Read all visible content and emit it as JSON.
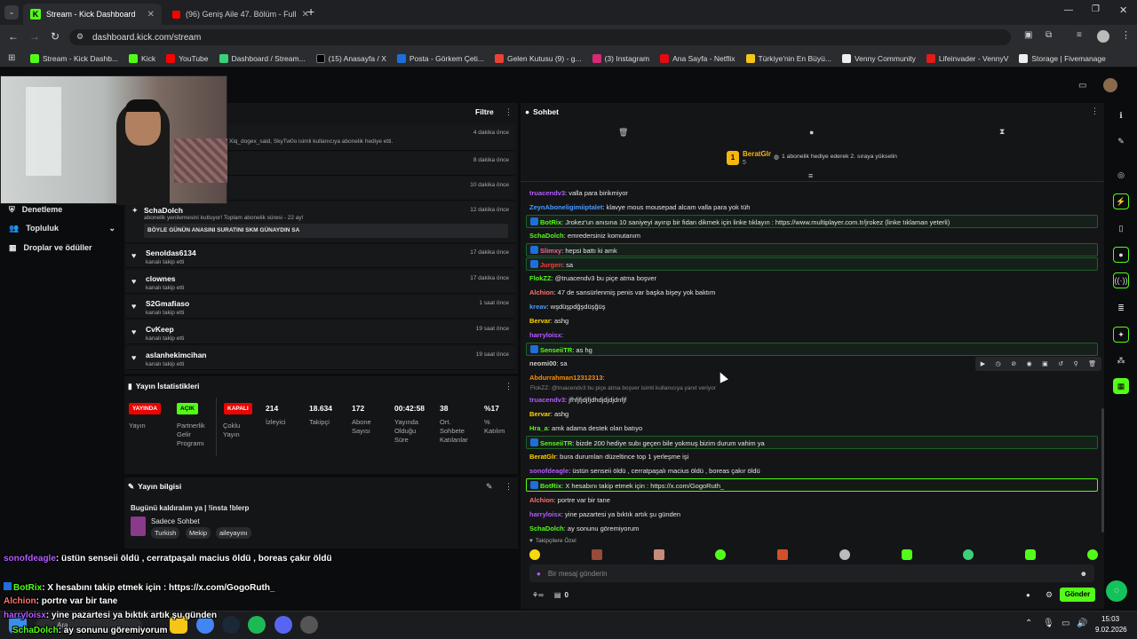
{
  "browser": {
    "tabs": [
      {
        "title": "Stream - Kick Dashboard",
        "active": true
      },
      {
        "title": "(96) Geniş Aile 47. Bölüm - Full",
        "active": false
      }
    ],
    "url": "dashboard.kick.com/stream",
    "bookmarks": [
      "Stream - Kick Dashb...",
      "Kick",
      "YouTube",
      "Dashboard / Stream...",
      "(15) Anasayfa / X",
      "Posta - Görkem Çeti...",
      "Gelen Kutusu (9) - g...",
      "(3) Instagram",
      "Ana Sayfa - Netflix",
      "Türkiye'nin En Büyü...",
      "Venny Community",
      "Lifeinvader - VennyV",
      "Storage | Fivemanage"
    ]
  },
  "sidebar": {
    "items": [
      {
        "label": "Denetleme"
      },
      {
        "label": "Topluluk"
      },
      {
        "label": "Droplar ve ödüller"
      }
    ]
  },
  "activity": {
    "filter_label": "Filtre",
    "rows": [
      {
        "name": "",
        "text": "Xiq_dogex_said, SkyTw0o isimli kullanıcıya abonelik hediye etti.",
        "time": "4 dakika önce"
      },
      {
        "name": "",
        "text": "",
        "time": "8 dakika önce"
      },
      {
        "name": "",
        "text": "",
        "time": "10 dakika önce"
      },
      {
        "name": "SchaDolch",
        "text": "abonelik yenilemesini kutluyor! Toplam abonelik süresi - 22 ay!",
        "time": "12 dakika önce",
        "message": "BÖYLE GÜNÜN ANASINI SURATINI SKM GÜNAYDIN SA"
      },
      {
        "name": "Senoldas6134",
        "text": "kanalı takip etti",
        "time": "17 dakika önce"
      },
      {
        "name": "clownes",
        "text": "kanalı takip etti",
        "time": "17 dakika önce"
      },
      {
        "name": "S2Gmafiaso",
        "text": "kanalı takip etti",
        "time": "1 saat önce"
      },
      {
        "name": "CvKeep",
        "text": "kanalı takip etti",
        "time": "19 saat önce"
      },
      {
        "name": "aslanhekimcihan",
        "text": "kanalı takip etti",
        "time": "19 saat önce"
      }
    ]
  },
  "stats": {
    "title": "Yayın İstatistikleri",
    "badges": [
      {
        "value": "YAYINDA",
        "label": "Yayın",
        "color": "#eb0400"
      },
      {
        "value": "AÇIK",
        "label": "Partnerlik Gelir Programı",
        "color": "#53fc18"
      },
      {
        "value": "KAPALI",
        "label": "Çoklu Yayın",
        "color": "#eb0400"
      }
    ],
    "numbers": [
      {
        "value": "214",
        "label": "İzleyici"
      },
      {
        "value": "18.634",
        "label": "Takipçi"
      },
      {
        "value": "172",
        "label": "Abone Sayısı"
      },
      {
        "value": "00:42:58",
        "label": "Yayında Olduğu Süre"
      },
      {
        "value": "38",
        "label": "Ort. Sohbete Katılanlar"
      },
      {
        "value": "%17",
        "label": "% Katılım"
      }
    ]
  },
  "stream_info": {
    "title": "Yayın bilgisi",
    "stream_title": "Bugünü kaldıralım ya | !insta !blerp",
    "category": "Sadece Sohbet",
    "tags": [
      "Turkish",
      "Mekip",
      "aileyayını"
    ]
  },
  "overlay_chat": [
    {
      "user": "sonofdeagle",
      "text": ": üstün senseii öldü , cerratpaşalı macius öldü , boreas çakır öldü",
      "color": "#b35cff"
    },
    {
      "user": "BotRix",
      "text": ": X hesabını takip etmek için : https://x.com/GogoRuth_",
      "color": "#53fc18"
    },
    {
      "user": "Alchion",
      "text": ": portre var bir tane",
      "color": "#ff7070"
    },
    {
      "user": "harryloisx",
      "text": ": yine pazartesi ya bıktık artık şu günden",
      "color": "#b35cff"
    },
    {
      "user": "SchaDolch",
      "text": ": ay sonunu göremiyorum",
      "color": "#53fc18"
    }
  ],
  "chat": {
    "title": "Sohbet",
    "pinned_user": "BeratGlr",
    "pinned_count": "5",
    "pinned_rank": "1",
    "pinned_text": "1 abonelik hediye ederek 2. sıraya yükselin",
    "reply_context": "FlokZZ: @truacendv3 bu piçe atma boşver isimli kullanıcıya yanıt veriyor",
    "messages": [
      {
        "user": "truacendv3",
        "text": ": valla para birikmiyor",
        "color": "#b35cff",
        "hl": ""
      },
      {
        "user": "ZeynAboneligimiiptalet",
        "text": ": klavye mous mousepad alcam valla para yok tüh",
        "color": "#4a9bff",
        "hl": ""
      },
      {
        "user": "BotRix",
        "text": ": Jrokez'un anısına 10 saniyeyi ayırıp bir fidan dikmek için linke tıklayın : https://www.multiplayer.com.tr/jrokez (linke tıklaman yeterli)",
        "color": "#53fc18",
        "hl": "hl"
      },
      {
        "user": "SchaDolch",
        "text": ": emredersiniz komutanım",
        "color": "#53fc18",
        "hl": ""
      },
      {
        "user": "Slimxy",
        "text": ": hepsi battı ki amk",
        "color": "#ff5ca8",
        "hl": "hl"
      },
      {
        "user": "Jurgen",
        "text": ": sa",
        "color": "#ff3b3b",
        "hl": "hl"
      },
      {
        "user": "FlokZZ",
        "text": ": @truacendv3 bu piçe atma boşver",
        "color": "#53fc18",
        "hl": ""
      },
      {
        "user": "Alchion",
        "text": ": 47 de sansürlenmiş penis var başka bişey yok baktım",
        "color": "#ff7070",
        "hl": ""
      },
      {
        "user": "kreav",
        "text": ": wşdüşpdğşdüşğüş",
        "color": "#4a9bff",
        "hl": ""
      },
      {
        "user": "Bervar",
        "text": ": ashg",
        "color": "#ffd400",
        "hl": ""
      },
      {
        "user": "harryloisx",
        "text": ":",
        "color": "#b35cff",
        "hl": ""
      },
      {
        "user": "SenseiiTR",
        "text": ": as hg",
        "color": "#53fc18",
        "hl": "hl"
      },
      {
        "user": "neomi00",
        "text": ": sa",
        "color": "#cfcfcf",
        "hl": ""
      },
      {
        "user": "Abdurrahman12312313",
        "text": ":",
        "color": "#ff8c00",
        "hl": ""
      },
      {
        "user": "truacendv3",
        "text": ": jfhfjfjdjfjdhdjdjdjdnfjf",
        "color": "#b35cff",
        "hl": ""
      },
      {
        "user": "Bervar",
        "text": ": ashg",
        "color": "#ffd400",
        "hl": ""
      },
      {
        "user": "Hra_a",
        "text": ": amk adama destek olan batıyo",
        "color": "#53fc18",
        "hl": ""
      },
      {
        "user": "SenseiiTR",
        "text": ": bizde 200 hediye subı geçen bile yokmuş bizim durum vahim ya",
        "color": "#53fc18",
        "hl": "hl"
      },
      {
        "user": "BeratGlr",
        "text": ": bura durumları düzeltince top 1 yerleşme işi",
        "color": "#ffd400",
        "hl": ""
      },
      {
        "user": "sonofdeagle",
        "text": ": üstün senseii öldü , cerratpaşalı macius öldü , boreas çakır öldü",
        "color": "#b35cff",
        "hl": ""
      },
      {
        "user": "BotRix",
        "text": ": X hesabını takip etmek için : https://x.com/GogoRuth_",
        "color": "#53fc18",
        "hl": "hl2"
      },
      {
        "user": "Alchion",
        "text": ": portre var bir tane",
        "color": "#ff7070",
        "hl": ""
      },
      {
        "user": "harryloisx",
        "text": ": yine pazartesi ya bıktık artık şu günden",
        "color": "#b35cff",
        "hl": ""
      },
      {
        "user": "SchaDolch",
        "text": ": ay sonunu göremiyorum",
        "color": "#53fc18",
        "hl": ""
      }
    ],
    "emote_section": "Takipçilere Özel",
    "input_placeholder": "Bir mesaj gönderin",
    "count": "0",
    "send_label": "Gönder"
  },
  "taskbar": {
    "search_label": "Ara",
    "time": "15:03",
    "date": "9.02.2026"
  }
}
